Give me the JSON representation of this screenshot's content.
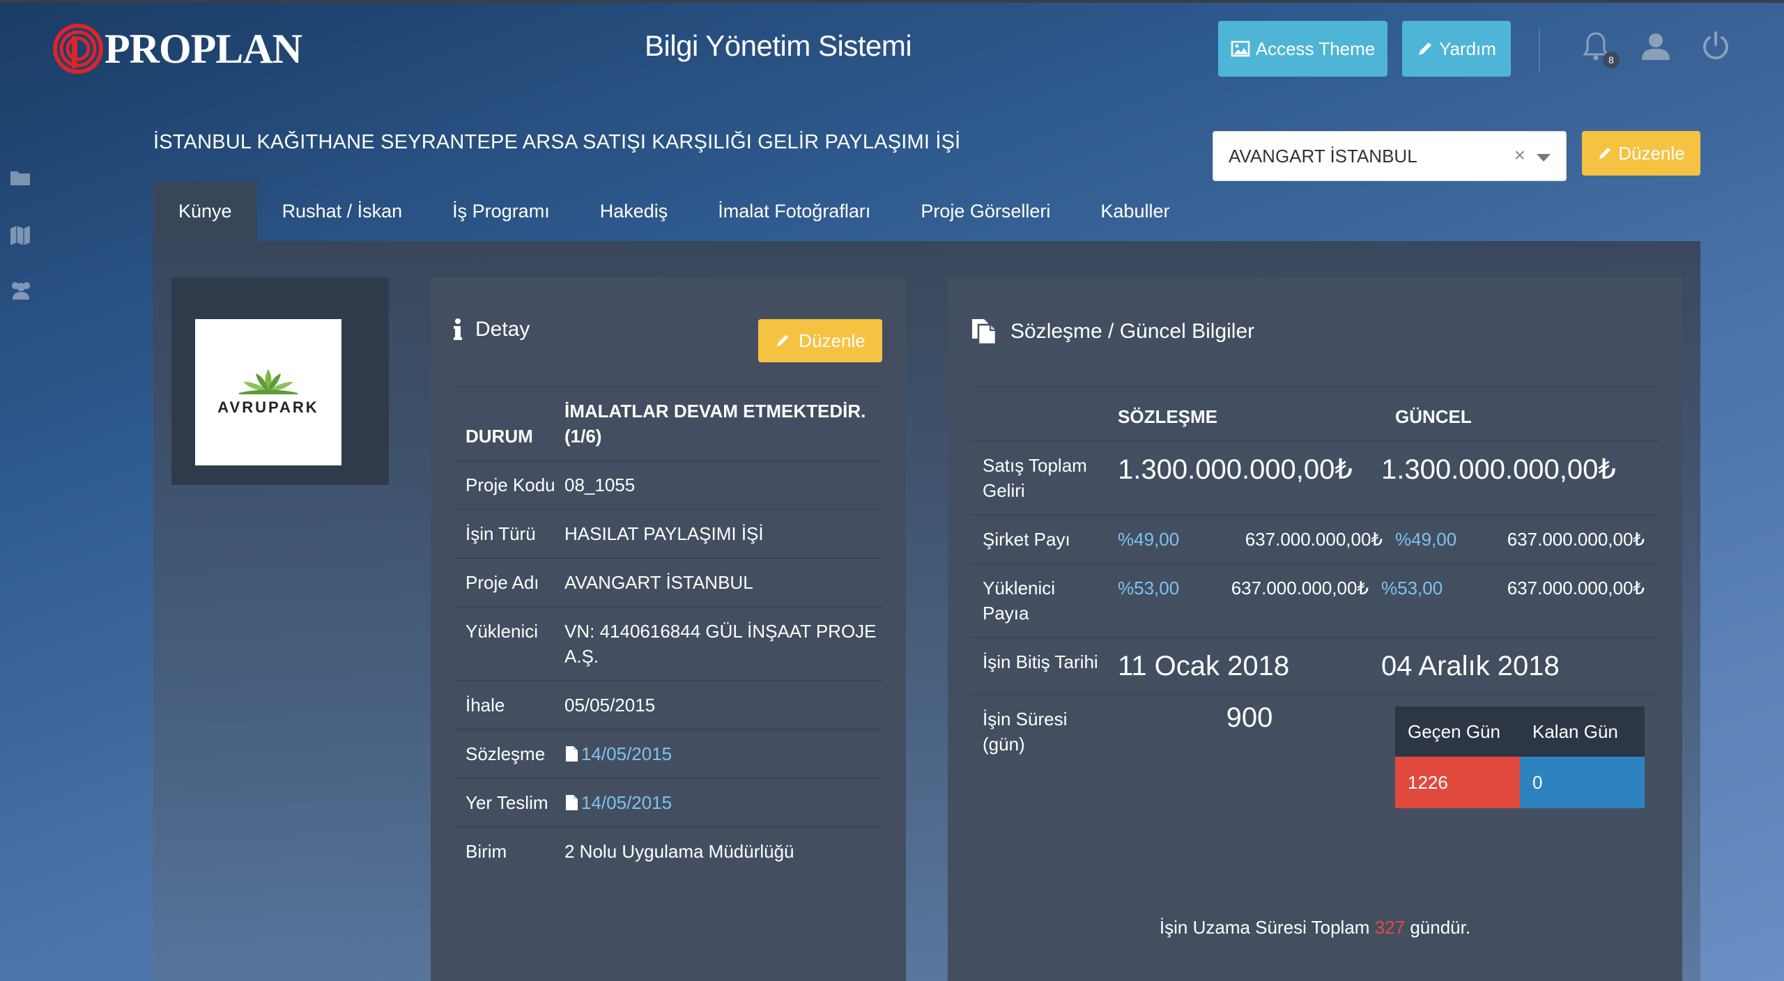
{
  "header": {
    "logo_text": "PROPLAN",
    "app_title": "Bilgi Yönetim Sistemi",
    "access_theme_label": "Access Theme",
    "help_label": "Yardım",
    "notification_count": "8",
    "icons": [
      "bell-icon",
      "user-icon",
      "power-icon",
      "image-icon",
      "pencil-icon"
    ]
  },
  "sidebar": {
    "icons": [
      "folder-icon",
      "map-icon",
      "users-icon"
    ]
  },
  "project": {
    "title": "İSTANBUL KAĞITHANE SEYRANTEPE ARSA SATIŞI KARŞILIĞI GELİR PAYLAŞIMI İŞİ",
    "selected_project": "AVANGART İSTANBUL",
    "edit_label": "Düzenle"
  },
  "tabs": [
    "Künye",
    "Rushat / İskan",
    "İş Programı",
    "Hakediş",
    "İmalat Fotoğrafları",
    "Proje Görselleri",
    "Kabuller"
  ],
  "logo_card": {
    "brand": "AVRUPARK"
  },
  "detail": {
    "heading": "Detay",
    "edit_label": "Düzenle",
    "rows": [
      {
        "key": "DURUM",
        "value": "İMALATLAR DEVAM ETMEKTEDİR. (1/6)"
      },
      {
        "key": "Proje Kodu",
        "value": "08_1055"
      },
      {
        "key": "İşin Türü",
        "value": "HASILAT PAYLAŞIMI İŞİ"
      },
      {
        "key": "Proje Adı",
        "value": "AVANGART İSTANBUL"
      },
      {
        "key": "Yüklenici",
        "value": "VN: 4140616844 GÜL İNŞAAT PROJE A.Ş."
      },
      {
        "key": "İhale",
        "value": "05/05/2015"
      },
      {
        "key": "Sözleşme",
        "value": "14/05/2015"
      },
      {
        "key": "Yer Teslim",
        "value": "14/05/2015"
      },
      {
        "key": "Birim",
        "value": "2 Nolu Uygulama Müdürlüğü"
      }
    ]
  },
  "contract": {
    "heading": "Sözleşme / Güncel Bilgiler",
    "col_contract": "SÖZLEŞME",
    "col_current": "GÜNCEL",
    "sales_total_label": "Satış Toplam Geliri",
    "sales_total_contract": "1.300.000.000,00₺",
    "sales_total_current": "1.300.000.000,00₺",
    "company_share_label": "Şirket Payı",
    "company_share_pct_contract": "%49,00",
    "company_share_amt_contract": "637.000.000,00₺",
    "company_share_pct_current": "%49,00",
    "company_share_amt_current": "637.000.000,00₺",
    "contractor_share_label": "Yüklenici Payıa",
    "contractor_share_pct_contract": "%53,00",
    "contractor_share_amt_contract": "637.000.000,00₺",
    "contractor_share_pct_current": "%53,00",
    "contractor_share_amt_current": "637.000.000,00₺",
    "end_date_label": "İşin Bitiş Tarihi",
    "end_date_contract": "11 Ocak 2018",
    "end_date_current": "04 Aralık 2018",
    "duration_label": "İşin Süresi (gün)",
    "duration_value": "900",
    "elapsed_label": "Geçen Gün",
    "remaining_label": "Kalan Gün",
    "elapsed_value": "1226",
    "remaining_value": "0",
    "extension_prefix": "İşin Uzama Süresi Toplam",
    "extension_value": "327",
    "extension_suffix": "gündür."
  },
  "colors": {
    "accent_blue": "#4fb5d6",
    "warning_yellow": "#f5c242",
    "danger_red": "#e2493d",
    "info_blue": "#2d82c0",
    "link_blue": "#7fc1f0"
  }
}
